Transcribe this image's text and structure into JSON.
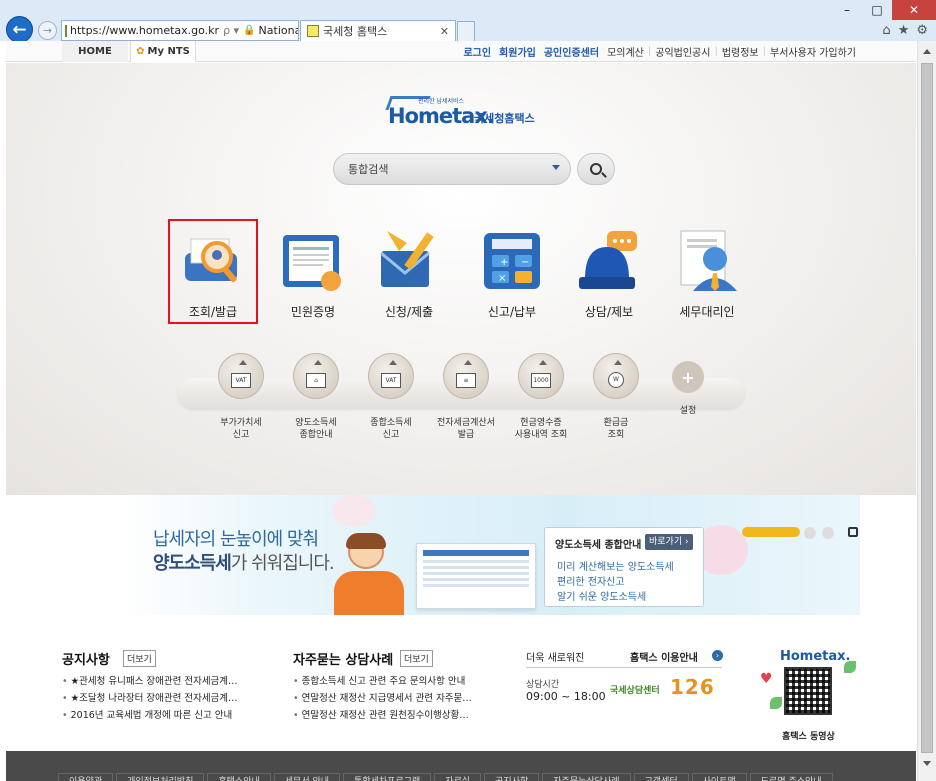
{
  "browser": {
    "address_url": "https://www.hometax.go.kr",
    "address_org": "National ...",
    "tab_title": "국세청 홈택스",
    "window_controls": [
      "minimize-icon",
      "maximize-icon",
      "close-icon"
    ],
    "tools": [
      "home-icon",
      "star-icon",
      "gear-icon"
    ]
  },
  "topbar": {
    "tabs": [
      "HOME",
      "My NTS"
    ],
    "links": [
      "로그인",
      "회원가입",
      "공인인증센터",
      "모의계산",
      "공익법인공시",
      "법령정보",
      "부서사용자 가입하기"
    ]
  },
  "logo": {
    "brand": "Hometax.",
    "korean": "국세청홈택스",
    "tagline": "편리한 납세서비스"
  },
  "search": {
    "placeholder": "통합검색"
  },
  "main_menu": [
    {
      "label": "조회/발급",
      "icon": "magnifier-doc-icon",
      "selected": true
    },
    {
      "label": "민원증명",
      "icon": "certificate-icon"
    },
    {
      "label": "신청/제출",
      "icon": "envelope-pencil-icon"
    },
    {
      "label": "신고/납부",
      "icon": "calculator-icon"
    },
    {
      "label": "상담/제보",
      "icon": "siren-chat-icon"
    },
    {
      "label": "세무대리인",
      "icon": "agent-icon"
    }
  ],
  "sub_menu": [
    {
      "line1": "부가가치세",
      "line2": "신고",
      "glyph": "VAT"
    },
    {
      "line1": "양도소득세",
      "line2": "종합안내",
      "glyph": "⌂"
    },
    {
      "line1": "종합소득세",
      "line2": "신고",
      "glyph": "VAT"
    },
    {
      "line1": "전자세금계산서",
      "line2": "발급",
      "glyph": "≡"
    },
    {
      "line1": "현금영수증",
      "line2": "사용내역 조회",
      "glyph": "1000"
    },
    {
      "line1": "환급금",
      "line2": "조회",
      "glyph": "W"
    },
    {
      "line1": "설정",
      "line2": "",
      "glyph": "+"
    }
  ],
  "banner": {
    "headline1": "납세자의 눈높이에 맞춰",
    "headline2_bold": "양도소득세",
    "headline2_rest": "가 쉬워집니다.",
    "box_title": "양도소득세 종합안내",
    "box_go": "바로가기 ›",
    "box_items": [
      "미리 계산해보는 양도소득세",
      "편리한 전자신고",
      "알기 쉬운 양도소득세"
    ]
  },
  "notices": {
    "title": "공지사항",
    "more": "더보기",
    "items": [
      "★관세청 유니패스 장애관련 전자세금계…",
      "★조달청 나라장터 장애관련 전자세금계…",
      "2016년 교육세법 개정에 따른 신고 안내"
    ]
  },
  "faq": {
    "title": "자주묻는 상담사례",
    "more": "더보기",
    "items": [
      "종합소득세 신고 관련 주요 문의사항 안내",
      "연말정산 재정산 지급명세서 관련 자주묻…",
      "연말정산 재정산 관련 원천징수이행상황…"
    ]
  },
  "info": {
    "new_label": "더욱 새로워진",
    "guide": "홈택스 이용안내",
    "hours_label": "상담시간",
    "hours": "09:00 ~ 18:00",
    "center": "국세상담센터",
    "number": "126"
  },
  "qr": {
    "logo": "Hometax.",
    "caption": "홈택스 동영상"
  },
  "footer": {
    "links": [
      "이용약관",
      "개인정보처리방침",
      "홈택스안내",
      "세무서 안내",
      "통합세차프로그램",
      "자료실",
      "공지사항",
      "자주묻는상담사례",
      "고객센터",
      "사이트맵",
      "도로명 주소안내"
    ]
  }
}
